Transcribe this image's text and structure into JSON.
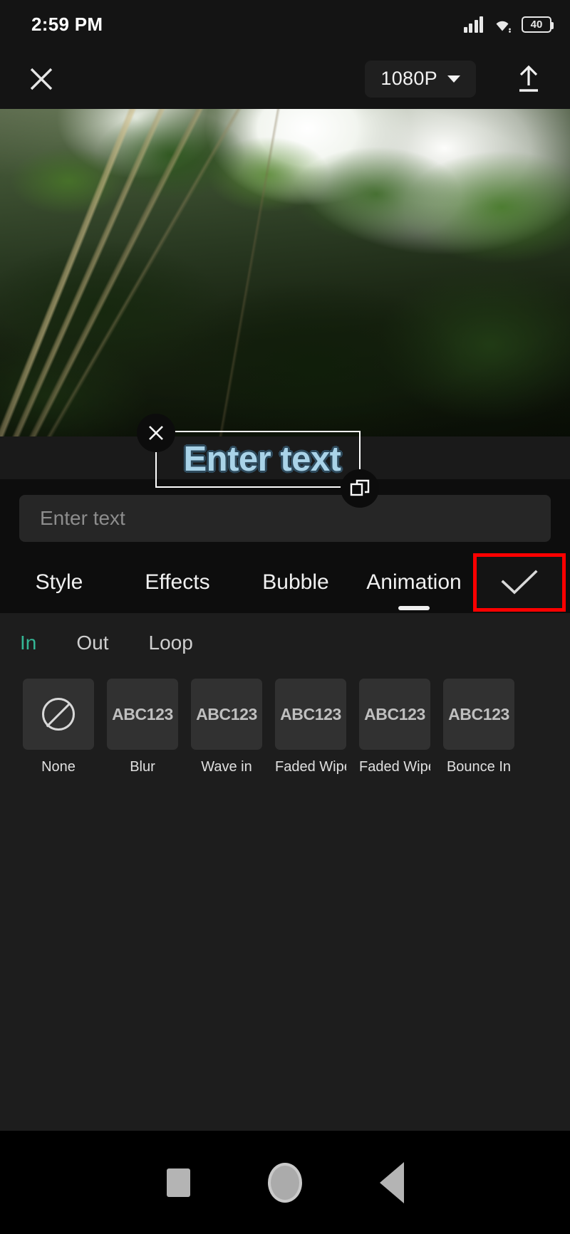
{
  "status_bar": {
    "time": "2:59 PM",
    "battery_level": "40",
    "signal_icon": "signal-bars-icon",
    "wifi_icon": "wifi-icon",
    "battery_icon": "battery-icon"
  },
  "top_bar": {
    "close_icon": "close-icon",
    "resolution": "1080P",
    "resolution_caret_icon": "chevron-down-icon",
    "export_icon": "upload-icon"
  },
  "preview": {
    "overlay_text": "Enter text",
    "overlay_text_color": "#a9d3e8",
    "overlay_outline_color": "#2e4a5c",
    "delete_handle_icon": "close-icon",
    "resize_handle_icon": "resize-corner-icon"
  },
  "text_input": {
    "value": "",
    "placeholder": "Enter text"
  },
  "tabs": [
    {
      "label": "Style",
      "active": false
    },
    {
      "label": "Effects",
      "active": false
    },
    {
      "label": "Bubble",
      "active": false
    },
    {
      "label": "Animation",
      "active": true
    }
  ],
  "confirm": {
    "icon": "checkmark-icon",
    "highlight_color": "#ff0000"
  },
  "sub_tabs": [
    {
      "label": "In",
      "active": true
    },
    {
      "label": "Out",
      "active": false
    },
    {
      "label": "Loop",
      "active": false
    }
  ],
  "active_sub_tab_color": "#34b796",
  "animation_cards": [
    {
      "label": "None",
      "preview": "",
      "icon": "no-sign-icon",
      "selected": true
    },
    {
      "label": "Blur",
      "preview": "ABC123",
      "icon": "",
      "selected": false
    },
    {
      "label": "Wave in",
      "preview": "ABC123",
      "icon": "",
      "selected": false
    },
    {
      "label": "Faded Wipe..",
      "preview": "ABC123",
      "icon": "",
      "selected": false
    },
    {
      "label": "Faded Wipe..",
      "preview": "ABC123",
      "icon": "",
      "selected": false
    },
    {
      "label": "Bounce In",
      "preview": "ABC123",
      "icon": "",
      "selected": false
    }
  ],
  "nav_bar": {
    "recents_icon": "square-icon",
    "home_icon": "circle-icon",
    "back_icon": "triangle-back-icon"
  }
}
